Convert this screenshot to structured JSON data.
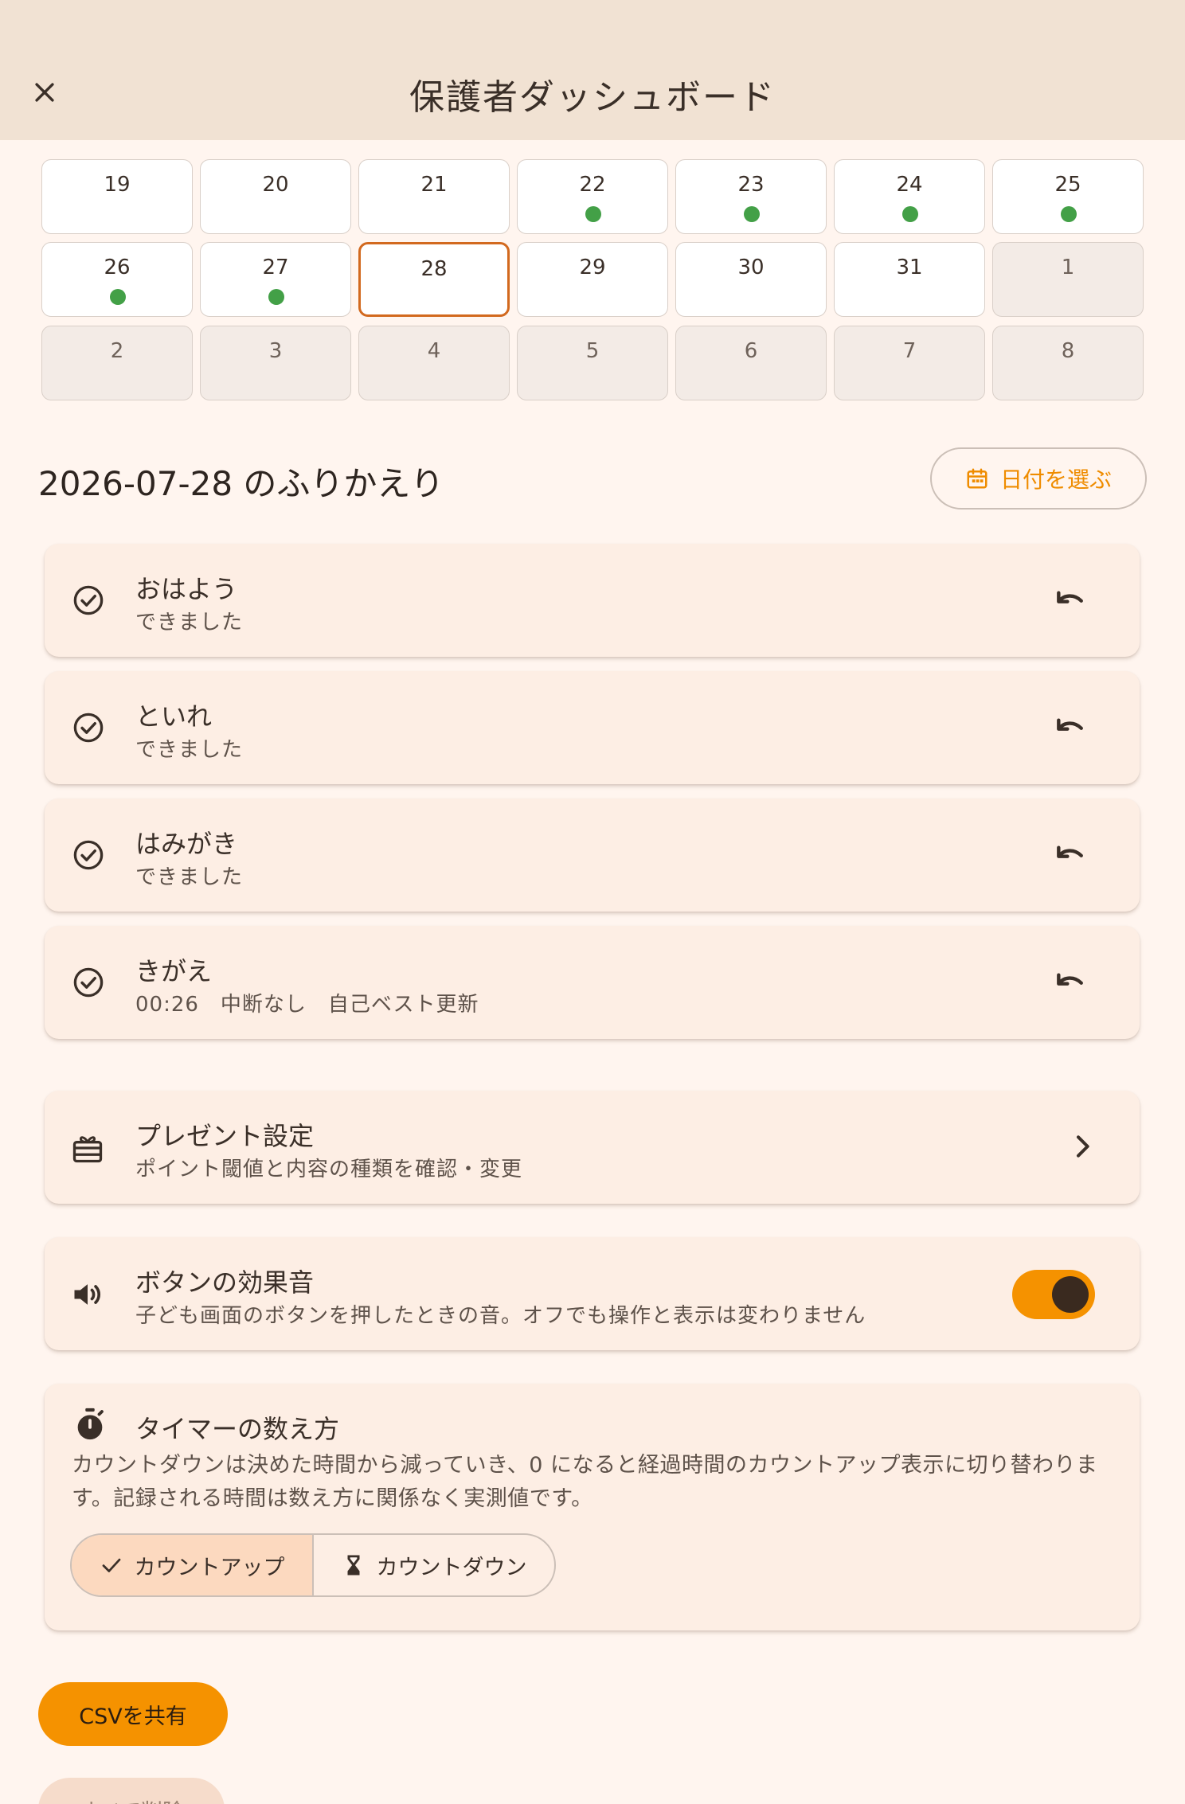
{
  "header": {
    "title": "保護者ダッシュボード"
  },
  "calendar": {
    "rows": [
      [
        {
          "day": "19",
          "done": false,
          "other": false,
          "selected": false
        },
        {
          "day": "20",
          "done": false,
          "other": false,
          "selected": false
        },
        {
          "day": "21",
          "done": false,
          "other": false,
          "selected": false
        },
        {
          "day": "22",
          "done": true,
          "other": false,
          "selected": false
        },
        {
          "day": "23",
          "done": true,
          "other": false,
          "selected": false
        },
        {
          "day": "24",
          "done": true,
          "other": false,
          "selected": false
        },
        {
          "day": "25",
          "done": true,
          "other": false,
          "selected": false
        }
      ],
      [
        {
          "day": "26",
          "done": true,
          "other": false,
          "selected": false
        },
        {
          "day": "27",
          "done": true,
          "other": false,
          "selected": false
        },
        {
          "day": "28",
          "done": false,
          "other": false,
          "selected": true
        },
        {
          "day": "29",
          "done": false,
          "other": false,
          "selected": false
        },
        {
          "day": "30",
          "done": false,
          "other": false,
          "selected": false
        },
        {
          "day": "31",
          "done": false,
          "other": false,
          "selected": false
        },
        {
          "day": "1",
          "done": false,
          "other": true,
          "selected": false
        }
      ],
      [
        {
          "day": "2",
          "done": false,
          "other": true,
          "selected": false
        },
        {
          "day": "3",
          "done": false,
          "other": true,
          "selected": false
        },
        {
          "day": "4",
          "done": false,
          "other": true,
          "selected": false
        },
        {
          "day": "5",
          "done": false,
          "other": true,
          "selected": false
        },
        {
          "day": "6",
          "done": false,
          "other": true,
          "selected": false
        },
        {
          "day": "7",
          "done": false,
          "other": true,
          "selected": false
        },
        {
          "day": "8",
          "done": false,
          "other": true,
          "selected": false
        }
      ]
    ]
  },
  "review": {
    "title": "2026-07-28 のふりかえり",
    "date_button": "日付を選ぶ",
    "tasks": [
      {
        "name": "おはよう",
        "status": "できました"
      },
      {
        "name": "といれ",
        "status": "できました"
      },
      {
        "name": "はみがき",
        "status": "できました"
      },
      {
        "name": "きがえ",
        "status": "00:26　中断なし　自己ベスト更新"
      }
    ]
  },
  "settings": {
    "present": {
      "title": "プレゼント設定",
      "subtitle": "ポイント閾値と内容の種類を確認・変更"
    },
    "sound": {
      "title": "ボタンの効果音",
      "subtitle": "子ども画面のボタンを押したときの音。オフでも操作と表示は変わりません",
      "enabled": true
    },
    "timer": {
      "title": "タイマーの数え方",
      "description": "カウントダウンは決めた時間から減っていき、0 になると経過時間のカウントアップ表示に切り替わります。記録される時間は数え方に関係なく実測値です。",
      "options": [
        "カウントアップ",
        "カウントダウン"
      ],
      "selected": "カウントアップ"
    }
  },
  "actions": {
    "csv_share": "CSVを共有",
    "reset": "すべて削除"
  },
  "colors": {
    "accent": "#f59200",
    "done_dot": "#43a047",
    "selected_border": "#d2691e",
    "appbar": "#f1e2d3"
  },
  "icons": {
    "close": "close-icon",
    "calendar": "calendar-icon",
    "check": "check-circle-icon",
    "undo": "undo-icon",
    "gift": "gift-icon",
    "speaker": "speaker-icon",
    "chevron": "chevron-right-icon",
    "stopwatch": "stopwatch-icon",
    "checkmark": "checkmark-icon",
    "hourglass": "hourglass-icon"
  }
}
